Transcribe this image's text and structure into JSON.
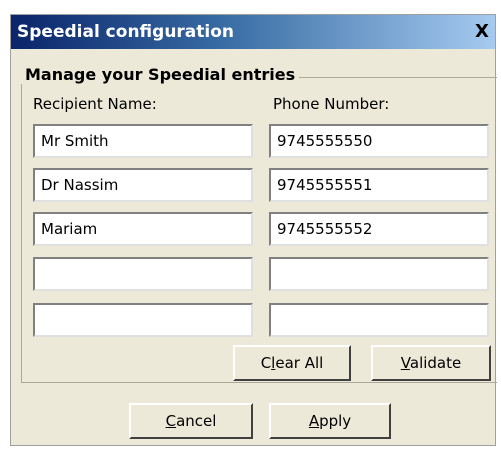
{
  "dialog": {
    "title": "Speedial configuration",
    "close_glyph": "X"
  },
  "group": {
    "legend": "Manage your Speedial entries",
    "col_name": "Recipient Name:",
    "col_phone": "Phone Number:"
  },
  "entries": [
    {
      "name": "Mr Smith",
      "phone": "9745555550"
    },
    {
      "name": "Dr Nassim",
      "phone": "9745555551"
    },
    {
      "name": "Mariam",
      "phone": "9745555552"
    },
    {
      "name": "",
      "phone": ""
    },
    {
      "name": "",
      "phone": ""
    }
  ],
  "buttons": {
    "clear_all": {
      "pre": "C",
      "mn": "l",
      "post": "ear All"
    },
    "validate": {
      "pre": "",
      "mn": "V",
      "post": "alidate"
    },
    "cancel": {
      "pre": "",
      "mn": "C",
      "post": "ancel"
    },
    "apply": {
      "pre": "",
      "mn": "A",
      "post": "pply"
    }
  }
}
